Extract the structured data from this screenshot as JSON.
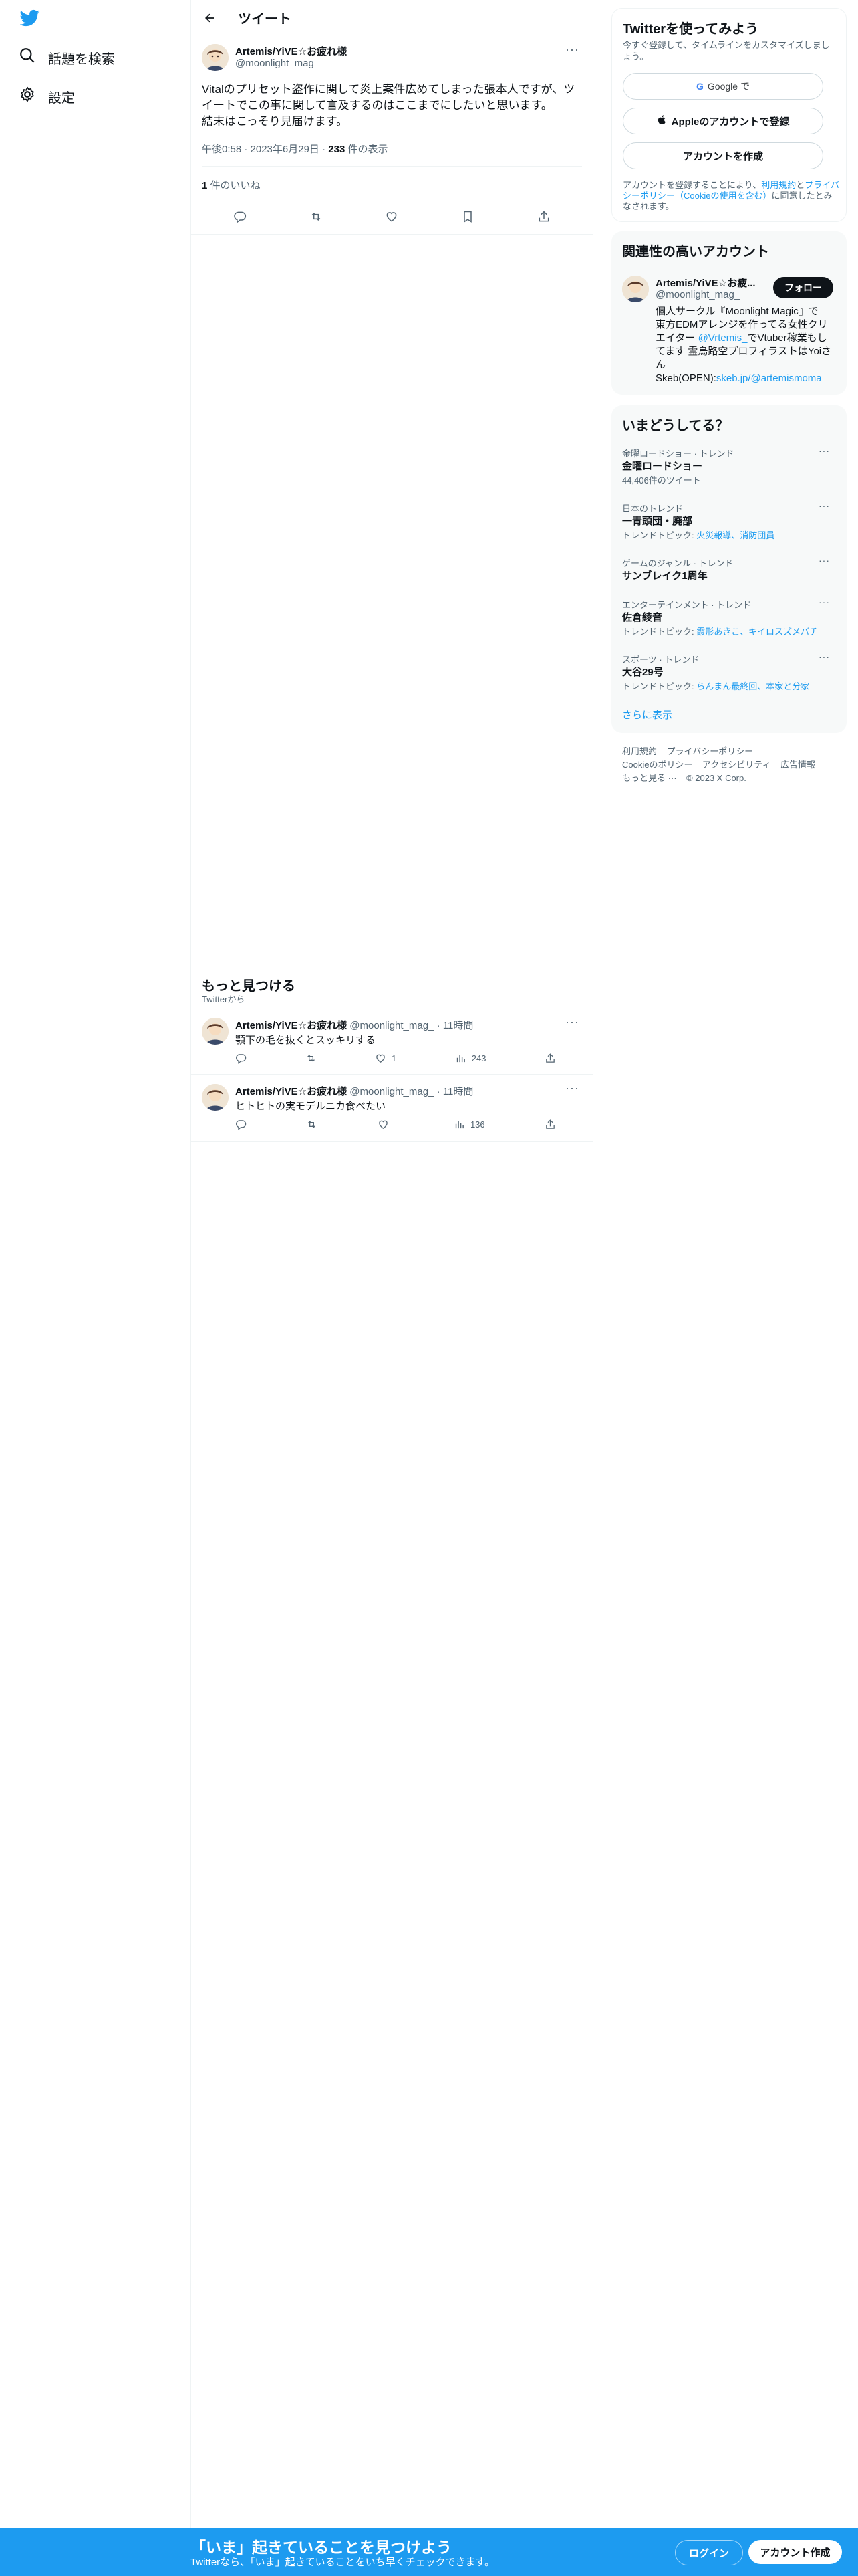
{
  "nav": {
    "search_label": "話題を検索",
    "settings_label": "設定"
  },
  "header": {
    "title": "ツイート"
  },
  "tweet": {
    "author_name": "Artemis/YiVE☆お疲れ様",
    "author_handle": "@moonlight_mag_",
    "text_line1": "Vitalのプリセット盗作に関して炎上案件広めてしまった張本人ですが、ツ",
    "text_line2": "イートでこの事に関して言及するのはここまでにしたいと思います。",
    "text_line3": "結末はこっそり見届けます。",
    "time": "午後0:58 · 2023年6月29日 · ",
    "views_count": "233",
    "views_label": " 件の表示",
    "likes_count": "1",
    "likes_label": " 件のいいね"
  },
  "discover": {
    "title": "もっと見つける",
    "subtitle": "Twitterから",
    "items": [
      {
        "author_name": "Artemis/YiVE☆お疲れ様",
        "author_handle": "@moonlight_mag_",
        "time": "· 11時間",
        "text": "顎下の毛を抜くとスッキリする",
        "likes": "1",
        "views": "243"
      },
      {
        "author_name": "Artemis/YiVE☆お疲れ様",
        "author_handle": "@moonlight_mag_",
        "time": "· 11時間",
        "text": "ヒトヒトの実モデルニカ食べたい",
        "likes": "",
        "views": "136"
      }
    ]
  },
  "signup": {
    "title": "Twitterを使ってみよう",
    "subtitle": "今すぐ登録して、タイムラインをカスタマイズしましょう。",
    "google_label": "Google で",
    "apple_label": "Appleのアカウントで登録",
    "create_label": "アカウントを作成",
    "terms_prefix": "アカウントを登録することにより、",
    "terms_link": "利用規約",
    "terms_and": "と",
    "privacy_link": "プライバシーポリシー",
    "cookie_link": "（Cookieの使用を含む）",
    "terms_suffix": "に同意したとみなされます。"
  },
  "related": {
    "title": "関連性の高いアカウント",
    "name": "Artemis/YiVE☆お疲...",
    "handle": "@moonlight_mag_",
    "follow_label": "フォロー",
    "bio_line1": "個人サークル『Moonlight Magic』で",
    "bio_line2": "東方EDMアレンジを作ってる女性クリ",
    "bio_line3_prefix": "エイター ",
    "bio_line3_link": "@Vrtemis_",
    "bio_line3_suffix": "でVtuber稼業もし",
    "bio_line4": "てます 霊烏路空プロフィラストはYoiさ",
    "bio_line5": "ん",
    "bio_line6_prefix": "Skeb(OPEN):",
    "bio_line6_link": "skeb.jp/@artemismoma"
  },
  "trends": {
    "title": "いまどうしてる？",
    "items": [
      {
        "category": "金曜ロードショー · トレンド",
        "name": "金曜ロードショー",
        "sub_prefix": "44,406件のツイート",
        "sub_links": ""
      },
      {
        "category": "日本のトレンド",
        "name": "一青頭団・廃部",
        "sub_prefix": "トレンドトピック: ",
        "sub_links": "火災報導、消防団員"
      },
      {
        "category": "ゲームのジャンル · トレンド",
        "name": "サンブレイク1周年",
        "sub_prefix": "",
        "sub_links": ""
      },
      {
        "category": "エンターテインメント · トレンド",
        "name": "佐倉綾音",
        "sub_prefix": "トレンドトピック: ",
        "sub_links": "霞形あきこ、キイロスズメバチ"
      },
      {
        "category": "スポーツ · トレンド",
        "name": "大谷29号",
        "sub_prefix": "トレンドトピック: ",
        "sub_links": "らんまん最終回、本家と分家"
      }
    ],
    "show_more": "さらに表示"
  },
  "footer": {
    "terms": "利用規約",
    "privacy": "プライバシーポリシー",
    "cookie": "Cookieのポリシー",
    "accessibility": "アクセシビリティ",
    "ads": "広告情報",
    "more": "もっと見る ···",
    "copyright": "© 2023 X Corp."
  },
  "bottombar": {
    "title": "「いま」起きていることを見つけよう",
    "subtitle": "Twitterなら、「いま」起きていることをいち早くチェックできます。",
    "login_label": "ログイン",
    "signup_label": "アカウント作成"
  },
  "colors": {
    "accent": "#1d9bf0",
    "text": "#0f1419",
    "secondary": "#536471",
    "card_bg": "#f7f9f9"
  }
}
